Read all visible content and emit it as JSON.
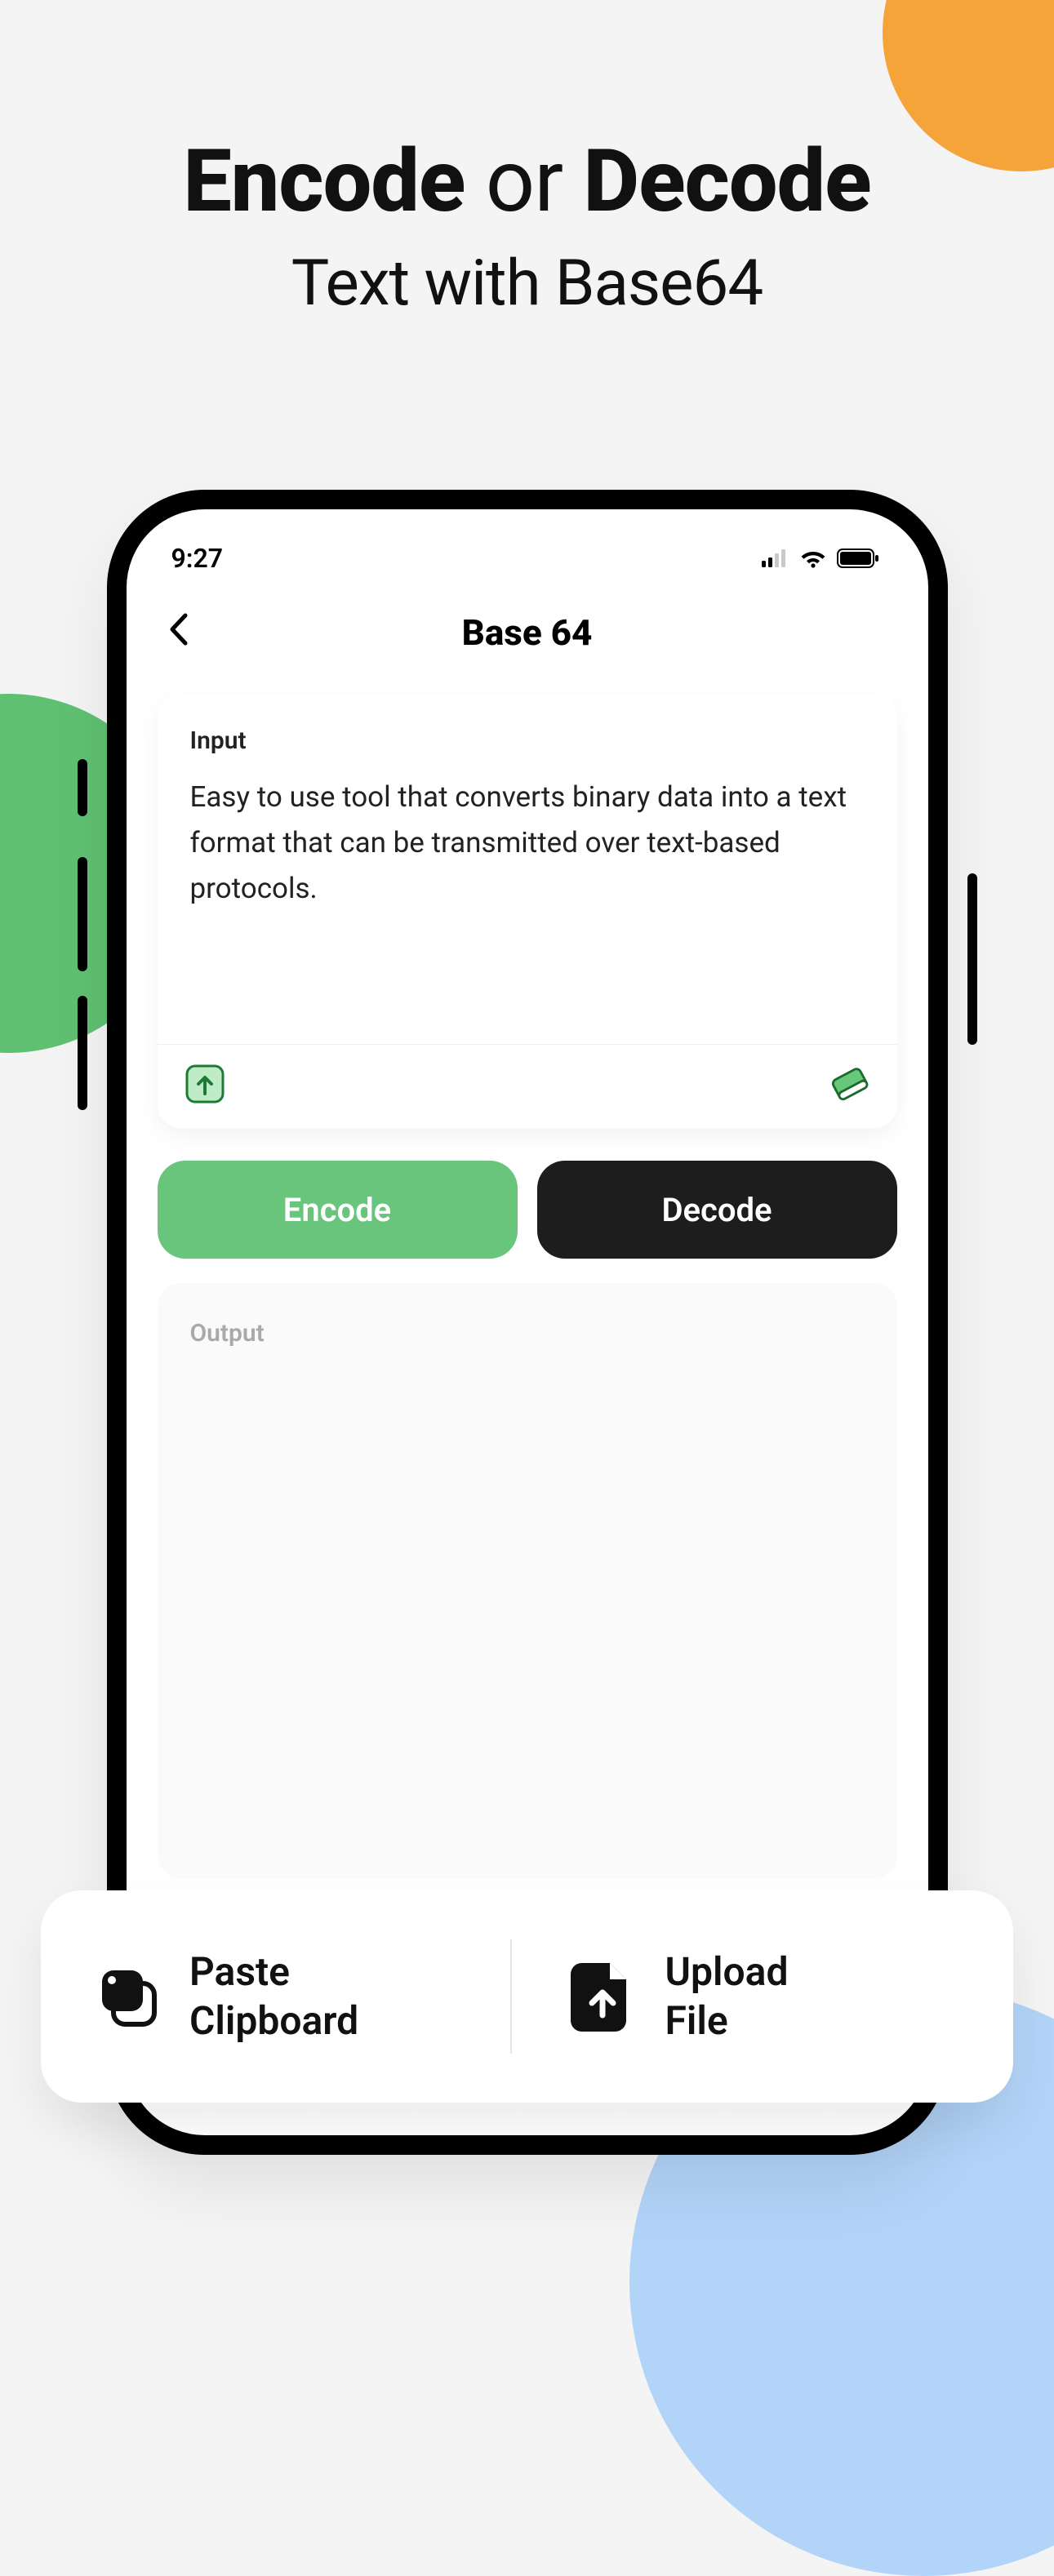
{
  "hero": {
    "encode": "Encode",
    "or": "or",
    "decode": "Decode",
    "subtitle": "Text with Base64"
  },
  "statusbar": {
    "time": "9:27"
  },
  "app": {
    "title": "Base 64",
    "input_label": "Input",
    "input_value": "Easy to use tool that converts binary data into a text format that can be transmitted over text-based protocols.",
    "output_label": "Output",
    "output_value": "",
    "encode_button": "Encode",
    "decode_button": "Decode"
  },
  "features": {
    "paste_line1": "Paste",
    "paste_line2": "Clipboard",
    "upload_line1": "Upload",
    "upload_line2": "File"
  },
  "colors": {
    "accent_green": "#69c47c",
    "dark": "#1d1d1d"
  }
}
